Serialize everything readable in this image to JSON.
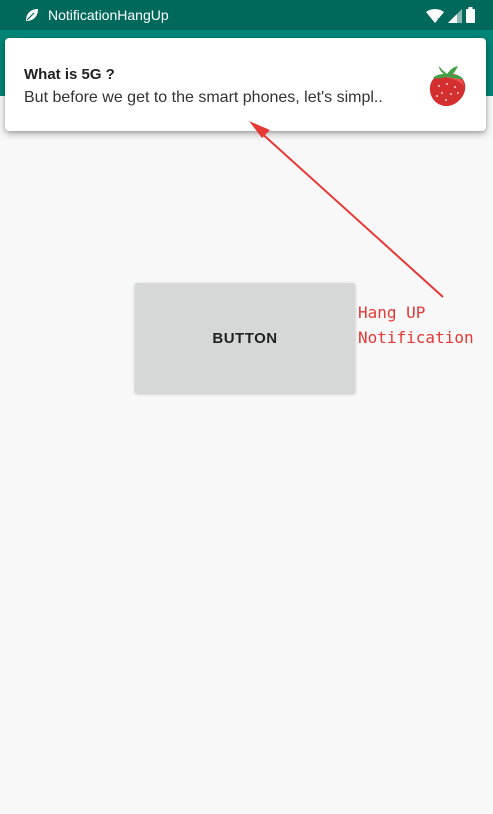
{
  "status_bar": {
    "app_name": "NotificationHangUp",
    "icons": [
      "leaf-icon",
      "wifi-icon",
      "signal-icon",
      "battery-icon"
    ]
  },
  "notification": {
    "title": "What is 5G ?",
    "text": "But before we get to the smart phones, let's simpl..",
    "large_icon": "strawberry-icon"
  },
  "main": {
    "button_label": "BUTTON"
  },
  "annotation": {
    "line1": "Hang UP",
    "line2": "Notification"
  },
  "colors": {
    "status_bar": "#00695c",
    "app_bar": "#008577",
    "background": "#f8f8f8",
    "button": "#d6d7d7",
    "annotation": "#e53935"
  }
}
